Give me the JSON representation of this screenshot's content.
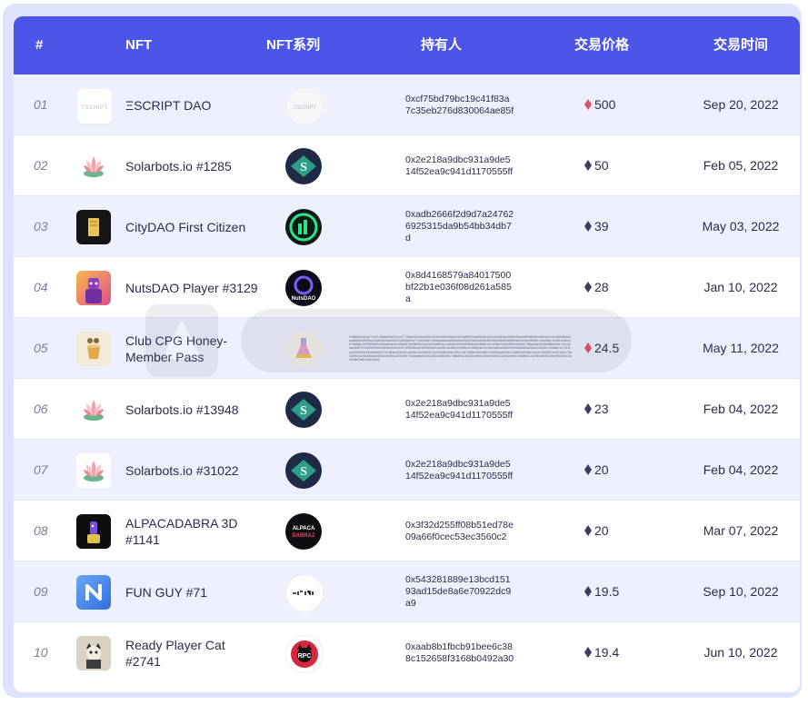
{
  "header": {
    "rank": "#",
    "nft": "NFT",
    "series": "NFT系列",
    "holder": "持有人",
    "price": "交易价格",
    "time": "交易时间"
  },
  "colors": {
    "header_bg": "#4d55e8",
    "row_alt": "#eef0fd",
    "eth_red": "#e0506a",
    "eth_dark": "#3a3f5c"
  },
  "rows": [
    {
      "rank": "01",
      "name": "ΞSCRIPT DAO",
      "holder": "0xcf75bd79bc19c41f83a7c35eb276d830064ae85f",
      "price": "500",
      "eth": "red",
      "date": "Sep 20, 2022",
      "icon": "escript-logo-icon",
      "series_icon": "escript-series-icon"
    },
    {
      "rank": "02",
      "name": "Solarbots.io #1285",
      "holder": "0x2e218a9dbc931a9de514f52ea9c941d1170555ff",
      "price": "50",
      "eth": "dark",
      "date": "Feb 05, 2022",
      "icon": "lotus-flower-icon",
      "series_icon": "solarbots-series-icon"
    },
    {
      "rank": "03",
      "name": "CityDAO First Citizen",
      "holder": "0xadb2666f2d9d7a247626925315da9b54bb34db7d",
      "price": "39",
      "eth": "dark",
      "date": "May 03, 2022",
      "icon": "gold-card-icon",
      "series_icon": "citydao-series-icon"
    },
    {
      "rank": "04",
      "name": "NutsDAO Player #3129",
      "holder": "0x8d4168579a84017500bf22b1e036f08d261a585a",
      "price": "28",
      "eth": "dark",
      "date": "Jan 10, 2022",
      "icon": "player-avatar-icon",
      "series_icon": "nutsdao-series-icon"
    },
    {
      "rank": "05",
      "name": "Club CPG Honey-Member Pass",
      "holder": "0x8f8b8d25e1b74201d8ddd9b810c7e4770b5fe0b0dac45f2b2b04e29f0b4fdce0a2344ff902c5b0bd0e0c4015c20f4d2598bed5da0fd94f8f50e5f5c0f4c51d1f0558ecfdaad5a5bd8559cec5a51b62a8dc6c52a53f0a59a77e3ed3407ef5a8a88ebcb5fa5c8e4ffa0f7afd25db69d5b38b5b3d65b8f89bfe81d9de4f5d9b14de5dbe1bd51ed4fbc7b76d5f6b12e9f9f3ef8d853fa4bd4e6e5a3f87be94e50e1b03fd15a89c14c3f0d2b59ef5d18b8c3f2a56af1d1c29bb2c36d48b9f65ed571f8ad3afc9d3bd58be2b17d2cd5da1a0bf7f20c0fd93f53e04b4bb9d1b22e7d5f0c5ad02b2ff3eb8e1b4d0b1da56f3cc9fe4a1e0565e4d2d1c6ebab9cd55eb0f2e8d56f83ac3a0d0c2d5b7d5a8eb1e7a1f2cc0ecb5b3e43b8d9e0d7f7e1df0acd3b2c3cc48dbc2e1f1b0f1c2c0d5df9b3f8c2f40c1bb7e85be9b5d6db7e48b8dd6f48b1f2c8f9b6b7a8e7abd7c0fa5ff12cba7c5ce73d0d6f51c3e5b30b4e8d8e2c3e8f0c1a7f2c5e7b3da6a6d5ea5c3f2b4a8e6a9c7d8e5b0a1f2d3c4e5f6a7b8c9d0e1f2a3b4c5d6e7f8a9b0c1d2e3f4a5b6c7d8e9f0a1b2c3d4e5f6a7b8c9d0e1f2a3",
      "price": "24.5",
      "eth": "red",
      "date": "May 11, 2022",
      "icon": "honey-cup-icon",
      "series_icon": "cpg-flask-series-icon"
    },
    {
      "rank": "06",
      "name": "Solarbots.io #13948",
      "holder": "0x2e218a9dbc931a9de514f52ea9c941d1170555ff",
      "price": "23",
      "eth": "dark",
      "date": "Feb 04, 2022",
      "icon": "lotus-flower-icon",
      "series_icon": "solarbots-series-icon"
    },
    {
      "rank": "07",
      "name": "Solarbots.io #31022",
      "holder": "0x2e218a9dbc931a9de514f52ea9c941d1170555ff",
      "price": "20",
      "eth": "dark",
      "date": "Feb 04, 2022",
      "icon": "lotus-flower-icon",
      "series_icon": "solarbots-series-icon"
    },
    {
      "rank": "08",
      "name": "ALPACADABRA 3D #1141",
      "holder": "0x3f32d255ff08b51ed78e09a66f0cec53ec3560c2",
      "price": "20",
      "eth": "dark",
      "date": "Mar 07, 2022",
      "icon": "alpaca-avatar-icon",
      "series_icon": "alpacadabraz-series-icon"
    },
    {
      "rank": "09",
      "name": "FUN GUY #71",
      "holder": "0x543281889e13bcd15193ad15de8a6e70922dc9a9",
      "price": "19.5",
      "eth": "dark",
      "date": "Sep 10, 2022",
      "icon": "fun-guy-logo-icon",
      "series_icon": "originals-series-icon"
    },
    {
      "rank": "10",
      "name": "Ready Player Cat #2741",
      "holder": "0xaab8b1fbcb91bee6c388c152658f3168b0492a30",
      "price": "19.4",
      "eth": "dark",
      "date": "Jun 10, 2022",
      "icon": "cat-avatar-icon",
      "series_icon": "ready-player-cat-series-icon"
    }
  ]
}
